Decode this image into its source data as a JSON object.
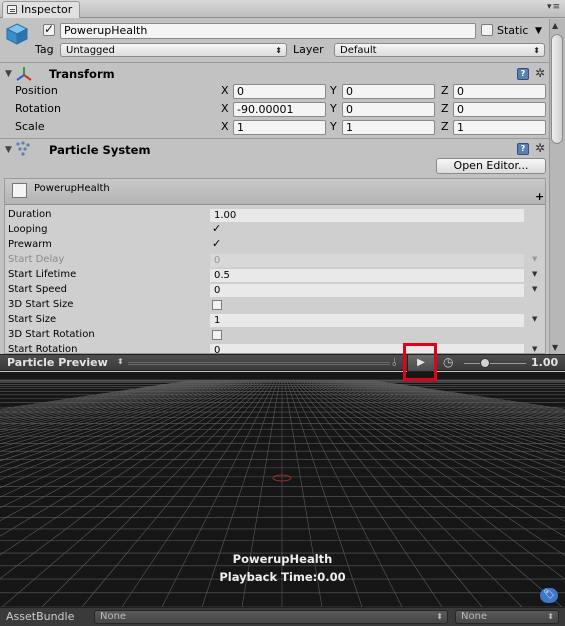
{
  "window": {
    "tab_label": "Inspector"
  },
  "object": {
    "name": "PowerupHealth",
    "active": true,
    "static_label": "Static",
    "static": false,
    "tag_label": "Tag",
    "tag_value": "Untagged",
    "layer_label": "Layer",
    "layer_value": "Default"
  },
  "transform": {
    "title": "Transform",
    "rows": [
      {
        "label": "Position",
        "x": "0",
        "y": "0",
        "z": "0"
      },
      {
        "label": "Rotation",
        "x": "-90.00001",
        "y": "0",
        "z": "0"
      },
      {
        "label": "Scale",
        "x": "1",
        "y": "1",
        "z": "1"
      }
    ],
    "axis": {
      "x": "X",
      "y": "Y",
      "z": "Z"
    }
  },
  "particle_system": {
    "title": "Particle System",
    "open_editor_label": "Open Editor...",
    "module_name": "PowerupHealth",
    "rows": [
      {
        "name": "Duration",
        "kind": "field",
        "value": "1.00"
      },
      {
        "name": "Looping",
        "kind": "check",
        "checked": true
      },
      {
        "name": "Prewarm",
        "kind": "check",
        "checked": true
      },
      {
        "name": "Start Delay",
        "kind": "field",
        "value": "0",
        "disabled": true,
        "dropdown": true
      },
      {
        "name": "Start Lifetime",
        "kind": "field",
        "value": "0.5",
        "dropdown": true
      },
      {
        "name": "Start Speed",
        "kind": "field",
        "value": "0",
        "dropdown": true
      },
      {
        "name": "3D Start Size",
        "kind": "check",
        "checked": false
      },
      {
        "name": "Start Size",
        "kind": "field",
        "value": "1",
        "dropdown": true
      },
      {
        "name": "3D Start Rotation",
        "kind": "check",
        "checked": false
      },
      {
        "name": "Start Rotation",
        "kind": "field",
        "value": "0",
        "dropdown": true
      }
    ]
  },
  "preview": {
    "title": "Particle Preview",
    "speed": "1.00",
    "play_icon": "play-icon",
    "object_name": "PowerupHealth",
    "playback_text": "Playback Time:0.00"
  },
  "asset_bundle": {
    "label": "AssetBundle",
    "name_value": "None",
    "variant_value": "None"
  },
  "colors": {
    "highlight": "#e2001a",
    "preview_bg": "#161616",
    "grid": "#5c5c5c"
  }
}
